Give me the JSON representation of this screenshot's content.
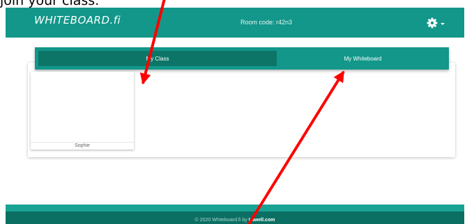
{
  "caption": "join your class.",
  "navbar": {
    "brand": "WHITEBOARD.fi",
    "room_code": "Room code: r42n3",
    "settings_icon": "gear-icon",
    "dropdown_icon": "caret-down-icon"
  },
  "tabs": [
    {
      "label": "My Class",
      "active": true
    },
    {
      "label": "My Whiteboard",
      "active": false
    }
  ],
  "students": [
    {
      "name": "Sophie"
    }
  ],
  "footer": {
    "prefix": "© 2020 Whiteboard.fi by ",
    "link": "Lawell.com"
  },
  "colors": {
    "primary": "#12978a",
    "primary_dark": "#0c7567",
    "footer": "#0b6f63",
    "annotation_arrow": "#ff0000"
  }
}
